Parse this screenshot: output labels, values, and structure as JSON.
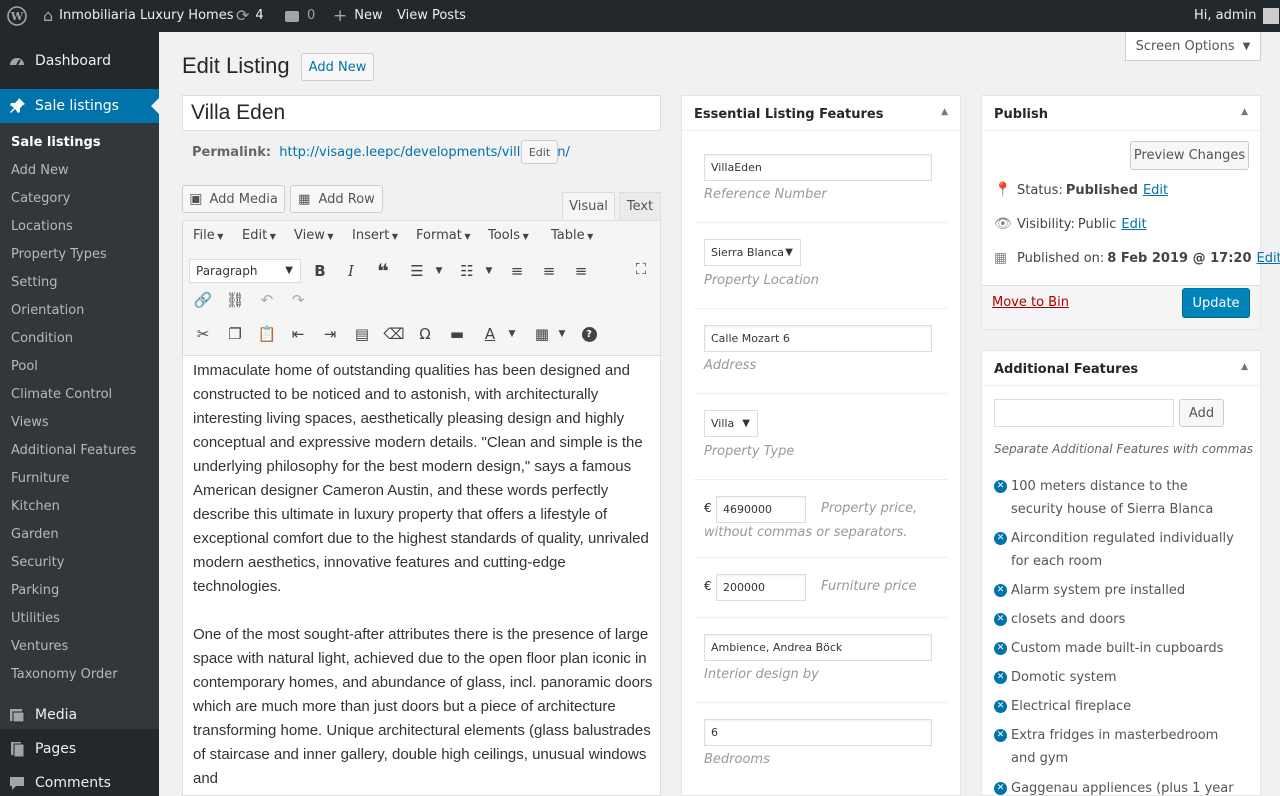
{
  "adminbar": {
    "site_name": "Inmobiliaria Luxury Homes",
    "updates_count": "4",
    "comments_count": "0",
    "new_label": "New",
    "view_posts": "View Posts",
    "greeting": "Hi, admin"
  },
  "sidebar": {
    "dashboard": "Dashboard",
    "sale_listings": "Sale listings",
    "submenu": [
      "Sale listings",
      "Add New",
      "Category",
      "Locations",
      "Property Types",
      "Setting",
      "Orientation",
      "Condition",
      "Pool",
      "Climate Control",
      "Views",
      "Additional Features",
      "Furniture",
      "Kitchen",
      "Garden",
      "Security",
      "Parking",
      "Utilities",
      "Ventures",
      "Taxonomy Order"
    ],
    "media": "Media",
    "pages": "Pages",
    "comments": "Comments"
  },
  "page": {
    "title": "Edit Listing",
    "add_new": "Add New",
    "screen_options": "Screen Options",
    "post_title": "Villa Eden",
    "permalink_label": "Permalink:",
    "permalink_url": "http://visage.leepc/developments/villa-eden/",
    "permalink_edit": "Edit"
  },
  "editor": {
    "add_media": "Add Media",
    "add_row": "Add Row",
    "tab_visual": "Visual",
    "tab_text": "Text",
    "menu": [
      "File",
      "Edit",
      "View",
      "Insert",
      "Format",
      "Tools",
      "Table"
    ],
    "format_select": "Paragraph",
    "paragraphs": [
      "Immaculate home of outstanding qualities has been designed and constructed to be noticed and to astonish, with architecturally interesting living spaces, aesthetically pleasing design and highly conceptual and expressive modern details. \"Clean and simple is the underlying philosophy for the best modern design,\" says a famous American designer Cameron Austin, and these words perfectly describe this ultimate in luxury property that offers a lifestyle of exceptional comfort due to the highest standards of quality, unrivaled modern aesthetics, innovative features and cutting-edge technologies.",
      "One of the most sought-after attributes there is the presence of large space with natural light, achieved due to the open floor plan iconic in contemporary homes, and abundance of glass, incl. panoramic doors which are much more than just doors but a piece of architecture transforming home. Unique architectural elements (glass balustrades of staircase and inner gallery, double high ceilings, unusual windows and"
    ]
  },
  "essential": {
    "title": "Essential Listing Features",
    "reference_value": "VillaEden",
    "reference_label": "Reference Number",
    "location_value": "Sierra Blanca",
    "location_label": "Property Location",
    "address_value": "Calle Mozart 6",
    "address_label": "Address",
    "type_value": "Villa",
    "type_label": "Property Type",
    "currency": "€",
    "price_value": "4690000",
    "price_label_1": "Property price,",
    "price_label_2": "without commas or separators.",
    "furniture_value": "200000",
    "furniture_label": "Furniture price",
    "interior_value": "Ambience,  Andrea Böck",
    "interior_label": "Interior design by",
    "bedrooms_value": "6",
    "bedrooms_label": "Bedrooms"
  },
  "publish": {
    "title": "Publish",
    "preview": "Preview Changes",
    "status_label": "Status: ",
    "status_value": "Published",
    "visibility_label": "Visibility: ",
    "visibility_value": "Public",
    "published_label": "Published on: ",
    "published_value": "8 Feb 2019 @ 17:20",
    "edit": "Edit",
    "move_to_bin": "Move to Bin",
    "update": "Update"
  },
  "additional": {
    "title": "Additional Features",
    "add": "Add",
    "hint": "Separate Additional Features with commas",
    "items": [
      "100 meters distance to the security house of Sierra Blanca",
      "Aircondition regulated individually for each room",
      "Alarm system pre installed",
      "closets and doors",
      "Custom made built-in cupboards",
      "Domotic system",
      "Electrical fireplace",
      "Extra fridges in masterbedroom and gym",
      "Gaggenau appliences (plus 1 year"
    ]
  },
  "colors": {
    "adminbar": "#23282d",
    "accent": "#0073aa",
    "submenu_bg": "#32373c",
    "danger": "#a00"
  }
}
